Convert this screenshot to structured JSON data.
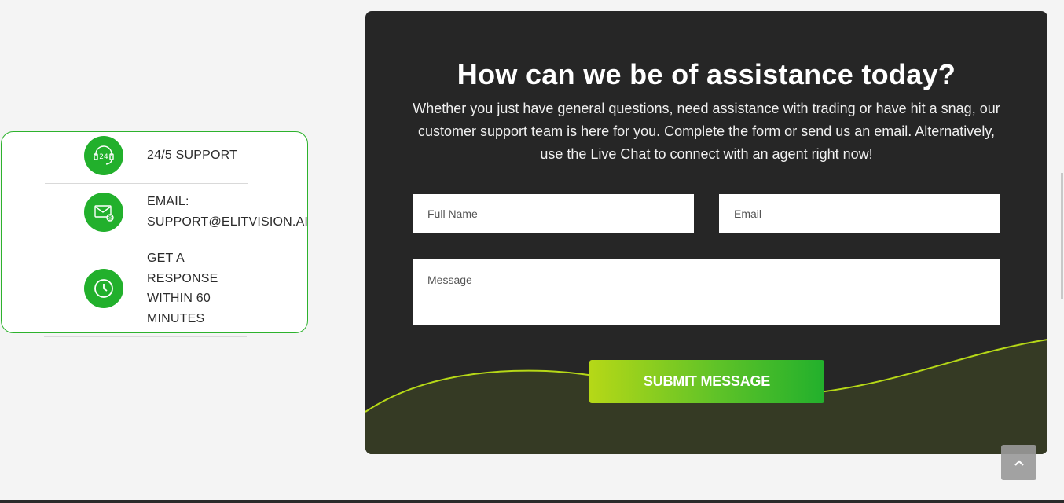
{
  "info": {
    "items": [
      {
        "icon": "headset-24-icon",
        "text": "24/5 SUPPORT"
      },
      {
        "icon": "email-icon",
        "line1": "EMAIL:",
        "line2": "SUPPORT@ELITVISION.AI"
      },
      {
        "icon": "clock-icon",
        "lines": [
          "GET A",
          "RESPONSE",
          "WITHIN 60",
          "MINUTES"
        ]
      }
    ]
  },
  "form": {
    "heading": "How can we be of assistance today?",
    "subtext_lines": [
      "Whether you just have general questions, need assistance with trading or have hit a snag, our",
      "customer support team is here for you. Complete the form or send us an email. Alternatively,",
      "use the Live Chat to connect with an agent right now!"
    ],
    "full_name": {
      "placeholder": "Full Name",
      "value": ""
    },
    "email": {
      "placeholder": "Email",
      "value": ""
    },
    "message": {
      "placeholder": "Message",
      "value": ""
    },
    "submit_label": "SUBMIT MESSAGE"
  },
  "colors": {
    "accent_green": "#22b02c",
    "accent_lime": "#b6d817",
    "card_dark": "#262626",
    "page_bg": "#f4f4f4"
  },
  "scroll_top": {
    "icon": "chevron-up-icon"
  }
}
